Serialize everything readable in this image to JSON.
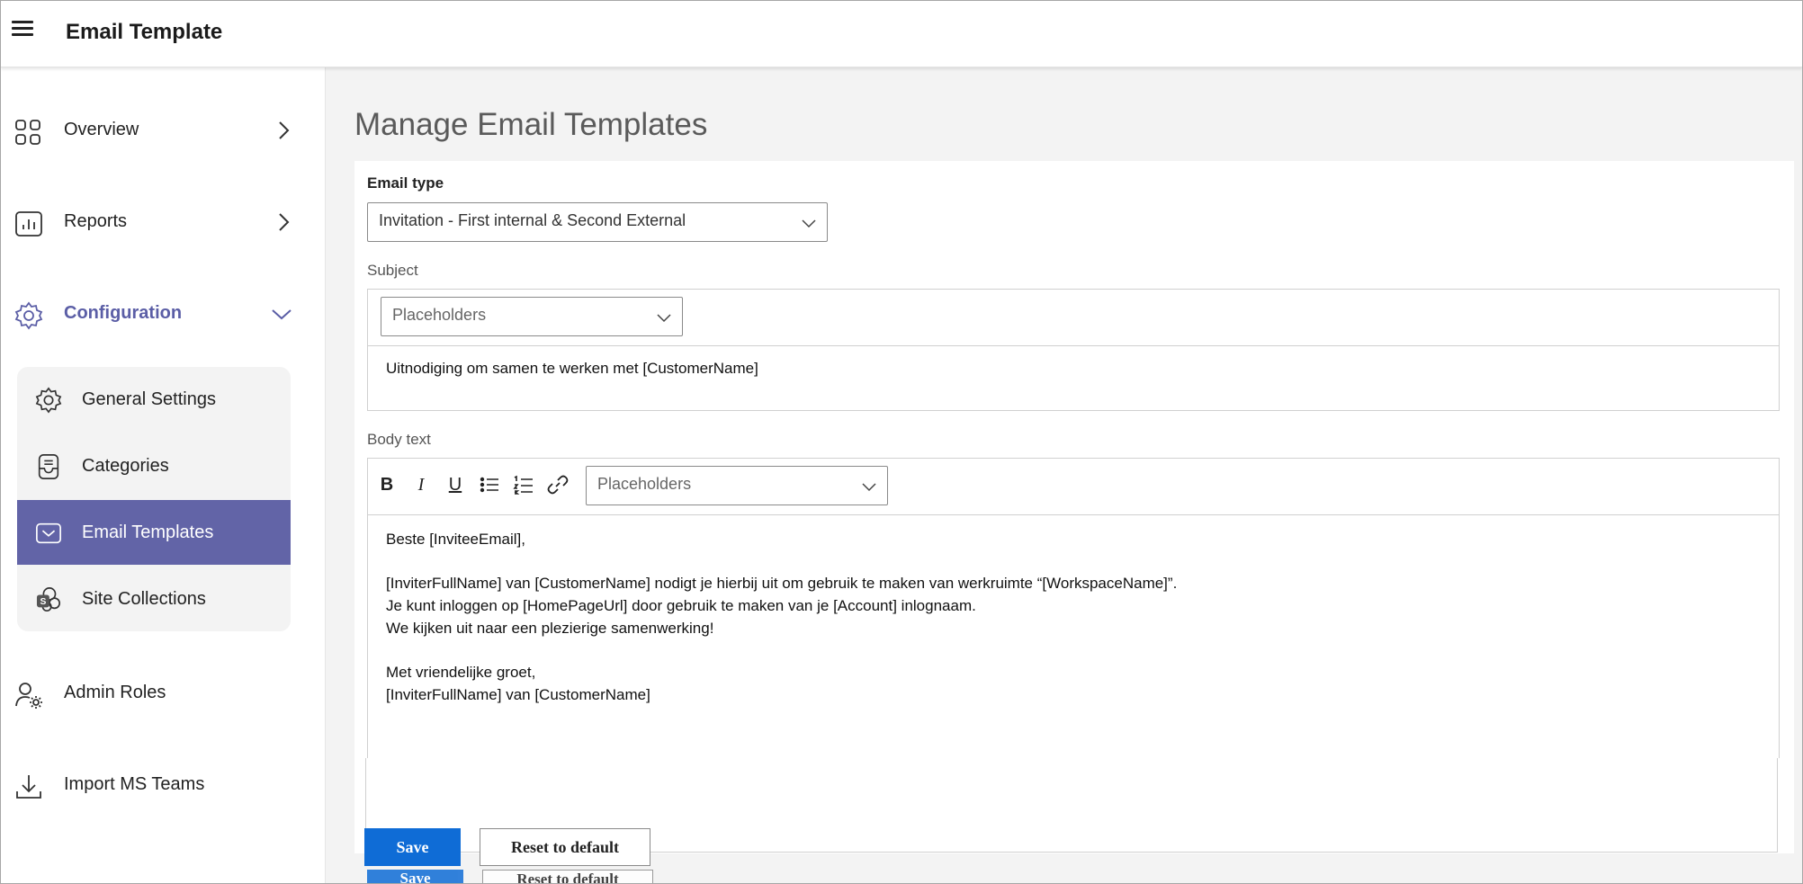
{
  "header": {
    "title": "Email Template"
  },
  "sidebar": {
    "items": [
      {
        "label": "Overview",
        "icon": "grid-icon"
      },
      {
        "label": "Reports",
        "icon": "chart-icon"
      },
      {
        "label": "Configuration",
        "icon": "gear-icon",
        "expanded": true
      },
      {
        "label": "Admin Roles",
        "icon": "user-gear-icon"
      },
      {
        "label": "Import MS Teams",
        "icon": "download-icon"
      }
    ],
    "sub_items": [
      {
        "label": "General Settings",
        "icon": "gear-icon"
      },
      {
        "label": "Categories",
        "icon": "tray-icon"
      },
      {
        "label": "Email Templates",
        "icon": "mail-icon",
        "selected": true
      },
      {
        "label": "Site Collections",
        "icon": "sharepoint-icon"
      }
    ]
  },
  "main": {
    "title": "Manage Email Templates",
    "email_type": {
      "label": "Email type",
      "value": "Invitation - First internal & Second External"
    },
    "subject": {
      "label": "Subject",
      "placeholder_select": "Placeholders",
      "text": "Uitnodiging om samen te werken met [CustomerName]"
    },
    "body": {
      "label": "Body text",
      "toolbar": {
        "bold": "B",
        "italic": "I",
        "underline": "U"
      },
      "placeholder_select": "Placeholders",
      "lines": [
        "Beste [InviteeEmail],",
        "",
        "[InviterFullName] van [CustomerName] nodigt je hierbij uit om gebruik te maken van werkruimte “[WorkspaceName]”.",
        "Je kunt inloggen op [HomePageUrl] door gebruik te maken van je [Account] inlognaam.",
        "We kijken uit naar een plezierige samenwerking!",
        "",
        "Met vriendelijke groet,",
        "[InviterFullName] van [CustomerName]"
      ]
    },
    "actions": {
      "save": "Save",
      "reset": "Reset to default"
    }
  },
  "colors": {
    "accent": "#6264a7",
    "primary_button": "#0f6cd6",
    "main_bg": "#f3f3f3"
  }
}
